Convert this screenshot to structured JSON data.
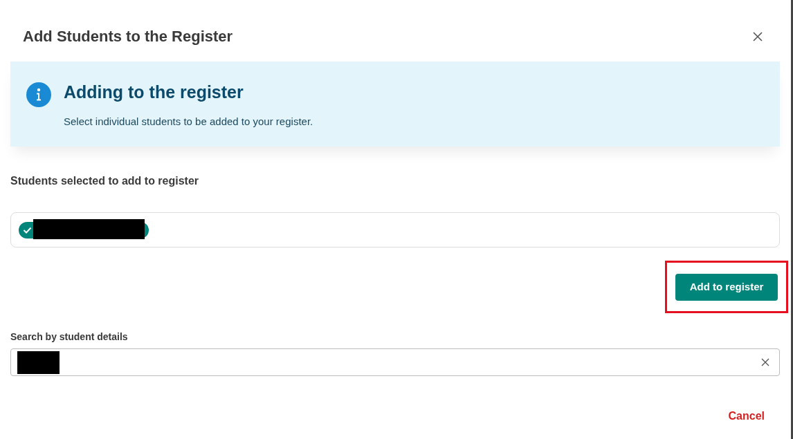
{
  "dialog": {
    "title": "Add Students to the Register"
  },
  "alert": {
    "heading": "Adding to the register",
    "text": "Select individual students to be added to your register."
  },
  "selected": {
    "label": "Students selected to add to register",
    "chips": [
      {
        "kind": "redacted"
      }
    ]
  },
  "add_button": {
    "label": "Add to register",
    "highlighted": true
  },
  "search": {
    "label": "Search by student details",
    "redacted": true
  },
  "cancel": {
    "label": "Cancel"
  }
}
